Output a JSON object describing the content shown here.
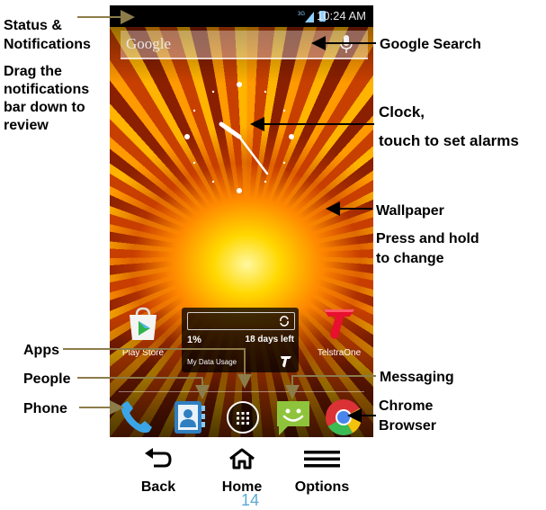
{
  "labels": {
    "status": "Status &\nNotifications",
    "drag": "Drag the\nnotifications\nbar down to\nreview",
    "google_search": "Google Search",
    "clock": "Clock,",
    "clock_sub": "touch to set alarms",
    "wallpaper": "Wallpaper",
    "wallpaper_sub": "Press and hold\nto change",
    "apps": "Apps",
    "people": "People",
    "phone": "Phone",
    "messaging": "Messaging",
    "chrome": "Chrome\nBrowser"
  },
  "screen": {
    "status_time": "10:24 AM",
    "network": "3G",
    "search_text": "Google",
    "apps": {
      "play_store": "Play Store",
      "telstra": "TelstraOne"
    },
    "widget": {
      "percent": "1%",
      "days_left": "18 days left",
      "name": "My Data Usage"
    }
  },
  "nav": {
    "back": "Back",
    "home": "Home",
    "options": "Options"
  },
  "page_number": "14",
  "colors": {
    "arrow": "#8c7c4a",
    "page_number": "#5aa9d6"
  }
}
